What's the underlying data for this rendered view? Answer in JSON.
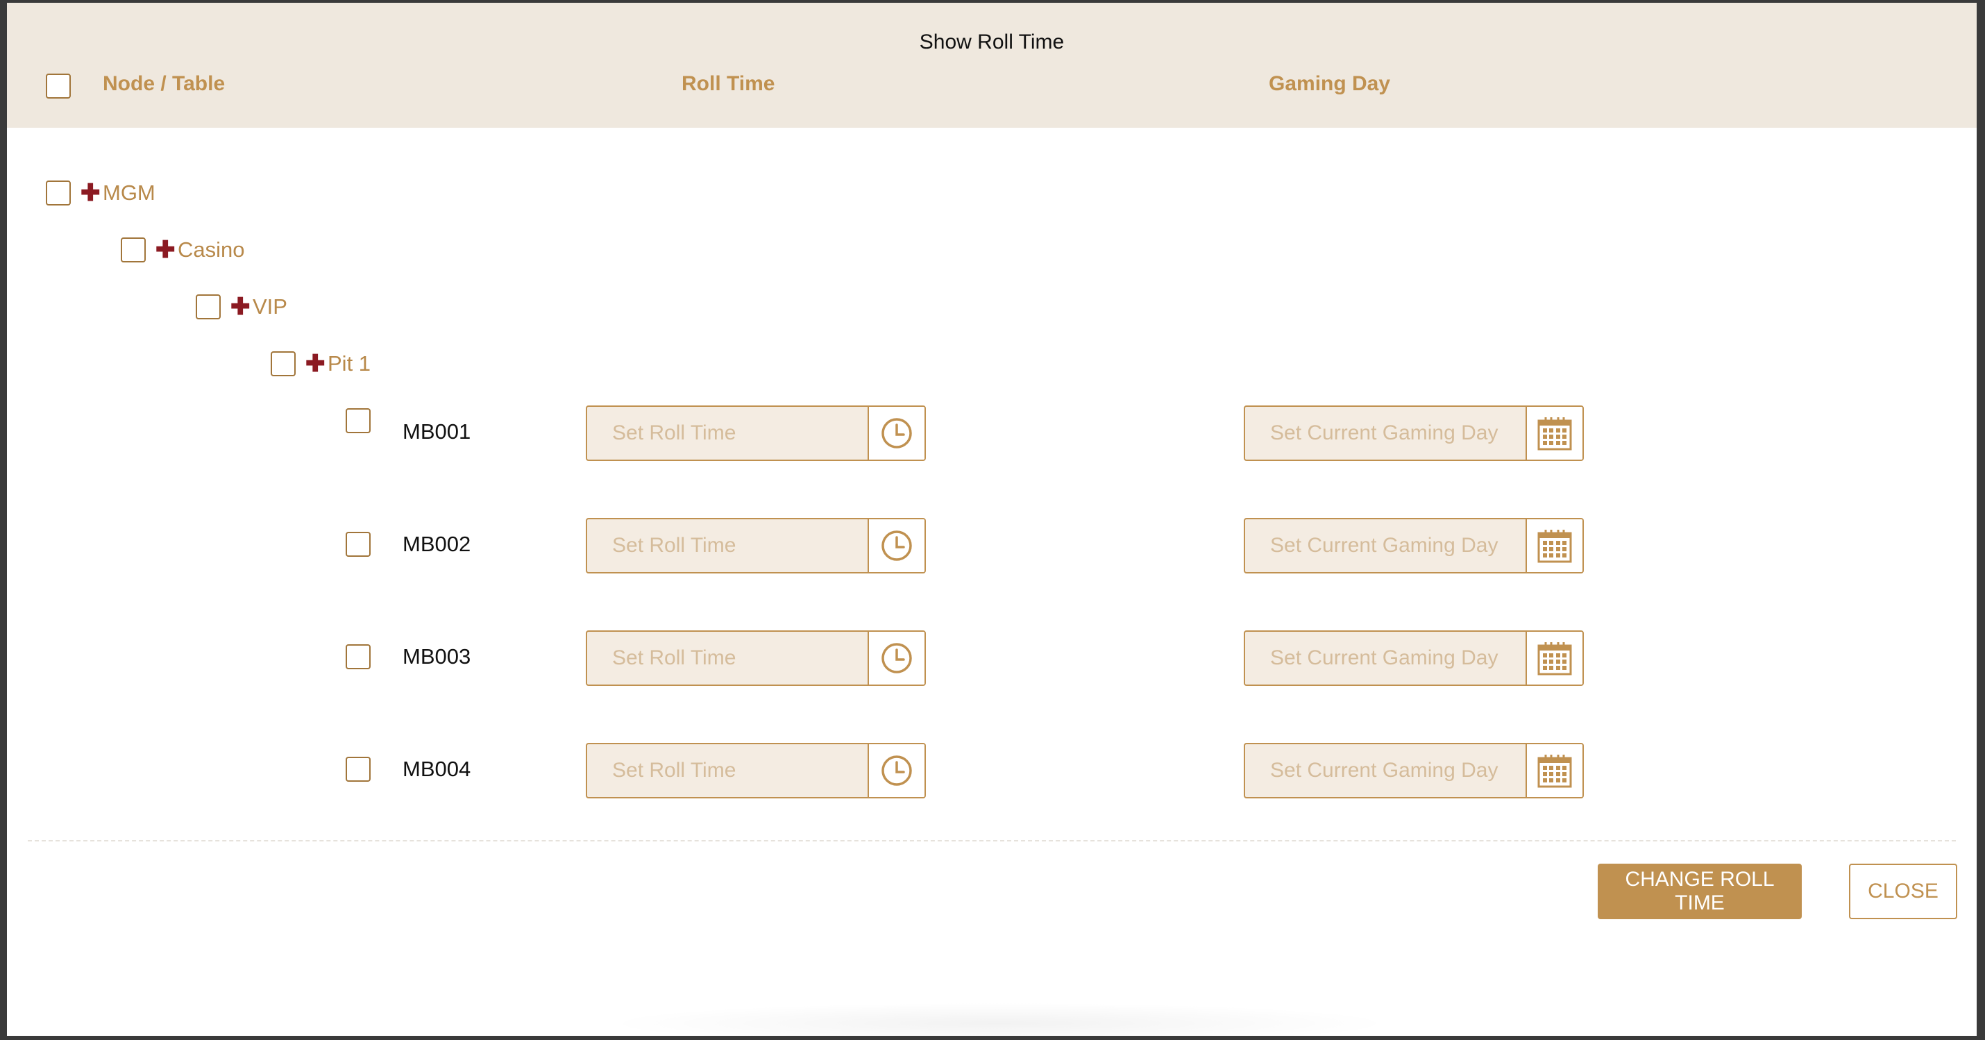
{
  "dialog": {
    "title": "Show Roll Time",
    "columns": {
      "node_table": "Node / Table",
      "roll_time": "Roll Time",
      "gaming_day": "Gaming Day"
    }
  },
  "tree": {
    "level0": "MGM",
    "level1": "Casino",
    "level2": "VIP",
    "level3": "Pit 1",
    "expand_symbol": "✚"
  },
  "tables": [
    {
      "name": "MB001",
      "roll_placeholder": "Set Roll Time",
      "day_placeholder": "Set Current Gaming Day"
    },
    {
      "name": "MB002",
      "roll_placeholder": "Set Roll Time",
      "day_placeholder": "Set Current Gaming Day"
    },
    {
      "name": "MB003",
      "roll_placeholder": "Set Roll Time",
      "day_placeholder": "Set Current Gaming Day"
    },
    {
      "name": "MB004",
      "roll_placeholder": "Set Roll Time",
      "day_placeholder": "Set Current Gaming Day"
    }
  ],
  "actions": {
    "change_roll_time": "CHANGE ROLL TIME",
    "close": "CLOSE"
  },
  "icons": {
    "time": "clock-icon",
    "date": "calendar-icon",
    "expand": "plus-icon"
  },
  "colors": {
    "accent": "#c09150",
    "header_bg": "#efe8de",
    "field_bg": "#f4ece2",
    "expand_icon": "#8b1a22",
    "placeholder": "#d5bc9b"
  }
}
